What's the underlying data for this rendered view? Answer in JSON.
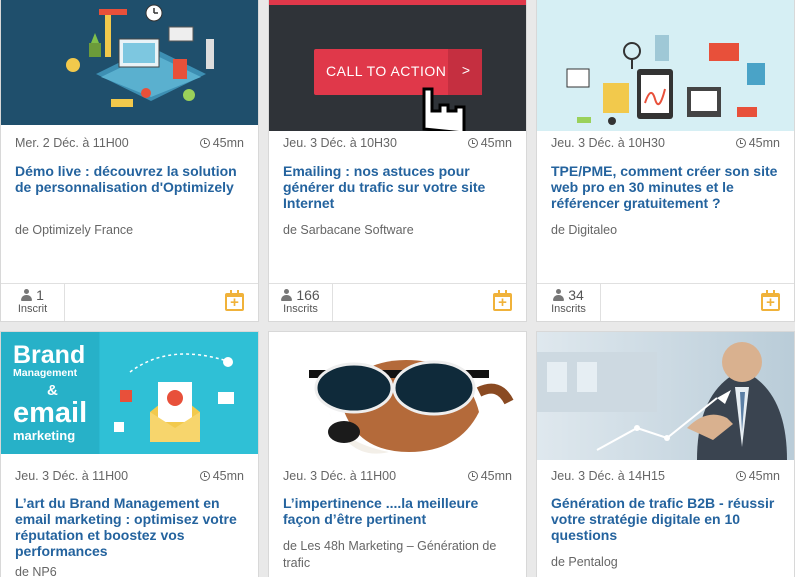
{
  "cards": [
    {
      "date": "Mer. 2 Déc. à 11H00",
      "duration": "45mn",
      "title": "Démo live : découvrez la solution de personnalisation d'Optimizely",
      "org": "de Optimizely France",
      "count": "1",
      "count_label": "Inscrit",
      "image": "isometric-workspace-illustration"
    },
    {
      "date": "Jeu. 3 Déc. à 10H30",
      "duration": "45mn",
      "title": "Emailing : nos astuces pour générer du trafic sur votre site Internet",
      "org": "de Sarbacane Software",
      "count": "166",
      "count_label": "Inscrits",
      "image_cta_label": "CALL TO ACTION",
      "image_cta_arrow": ">"
    },
    {
      "date": "Jeu. 3 Déc. à 10H30",
      "duration": "45mn",
      "title": "TPE/PME, comment créer son site web pro en 30 minutes et le référencer gratuitement ?",
      "org": "de Digitaleo",
      "count": "34",
      "count_label": "Inscrits",
      "image": "ecommerce-icons-illustration"
    },
    {
      "date": "Jeu. 3 Déc. à 11H00",
      "duration": "45mn",
      "title": "L’art du Brand Management en email marketing : optimisez votre réputation et boostez vos performances",
      "org": "de NP6",
      "image_brand": "Brand",
      "image_management": "Management",
      "image_amp": "&",
      "image_email": "email",
      "image_marketing": "marketing"
    },
    {
      "date": "Jeu. 3 Déc. à 11H00",
      "duration": "45mn",
      "title": "L’impertinence ....la meilleure façon d’être pertinent",
      "org": "de Les 48h Marketing – Génération de trafic",
      "image": "dog-with-sunglasses"
    },
    {
      "date": "Jeu. 3 Déc. à 14H15",
      "duration": "45mn",
      "title": "Génération de trafic B2B - réussir votre stratégie digitale en 10 questions",
      "org": "de Pentalog",
      "image": "businessman-growth-chart"
    }
  ],
  "colors": {
    "title": "#24639e",
    "accent_calendar": "#f0b23a",
    "cta_red": "#e0384a"
  }
}
